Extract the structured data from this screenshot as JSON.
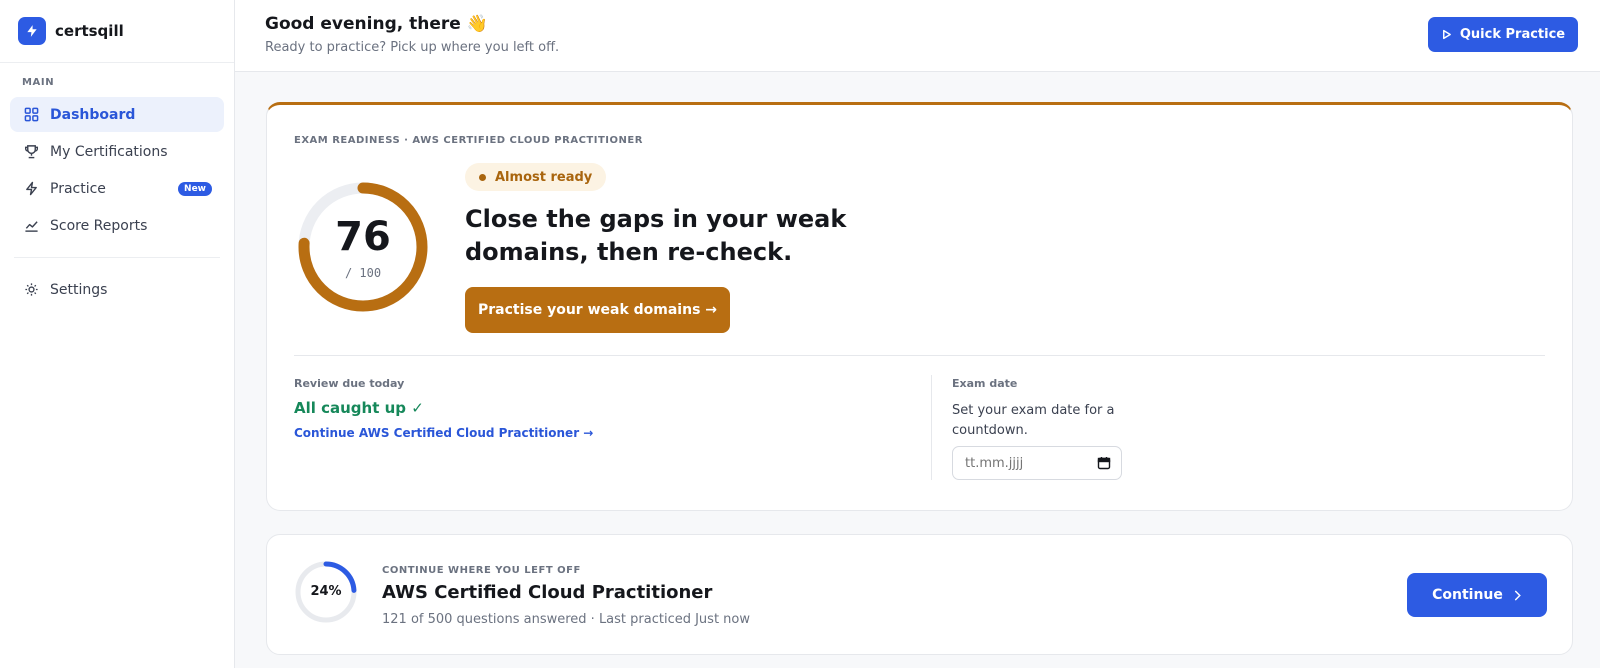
{
  "app": {
    "name": "certsqill"
  },
  "sidebar": {
    "section_label": "MAIN",
    "items": [
      {
        "label": "Dashboard",
        "icon": "grid-icon",
        "active": true
      },
      {
        "label": "My Certifications",
        "icon": "trophy-icon"
      },
      {
        "label": "Practice",
        "icon": "bolt-icon",
        "badge": "New"
      },
      {
        "label": "Score Reports",
        "icon": "chart-line-icon"
      }
    ],
    "settings_label": "Settings"
  },
  "header": {
    "greeting": "Good evening, there 👋",
    "subtitle": "Ready to practice? Pick up where you left off.",
    "quick_practice_label": "Quick Practice"
  },
  "readiness": {
    "eyebrow": "EXAM READINESS · AWS CERTIFIED CLOUD PRACTITIONER",
    "score": "76",
    "score_max": "/ 100",
    "score_fraction": 0.76,
    "status_pill": "Almost ready",
    "headline": "Close the gaps in your weak domains, then re-check.",
    "cta_label": "Practise your weak domains →",
    "review_label": "Review due today",
    "review_status": "All caught up ✓",
    "continue_link": "Continue AWS Certified Cloud Practitioner →",
    "exam_date_label": "Exam date",
    "exam_date_help": "Set your exam date for a countdown.",
    "exam_date_placeholder": "tt.mm.jjjj",
    "accent_color": "#b86e12"
  },
  "continue_card": {
    "eyebrow": "CONTINUE WHERE YOU LEFT OFF",
    "progress_label": "24%",
    "progress_fraction": 0.24,
    "title": "AWS Certified Cloud Practitioner",
    "meta": "121 of 500 questions answered · Last practiced Just now",
    "button_label": "Continue"
  }
}
